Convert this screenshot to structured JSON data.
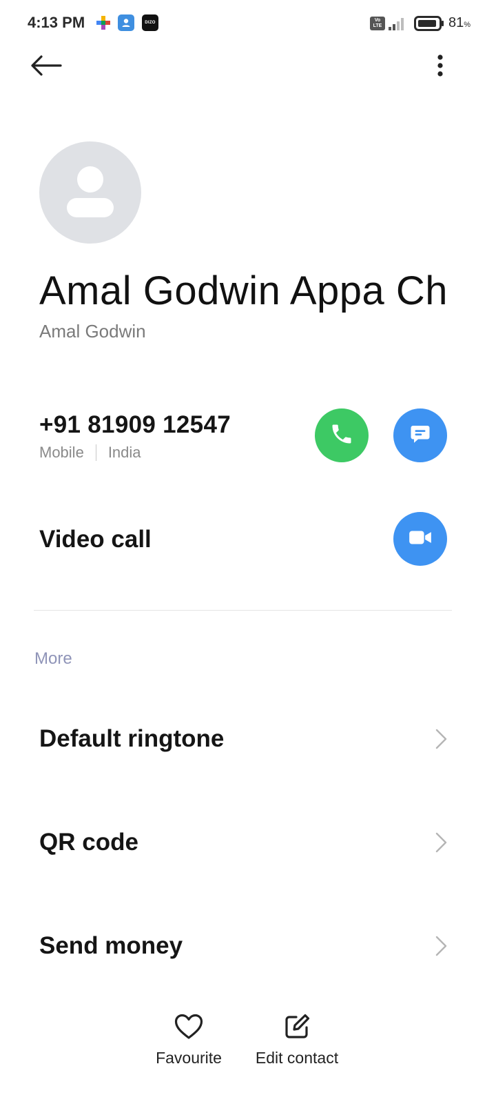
{
  "status_bar": {
    "time": "4:13 PM",
    "icons": [
      "puzzle-app-icon",
      "contacts-app-icon",
      "dizo-app-icon"
    ],
    "dizo_label": "DIZO",
    "volte_label": "Vo LTE",
    "battery_value": "81",
    "battery_unit": "%"
  },
  "top_bar": {
    "back_icon": "back-arrow-icon",
    "more_icon": "more-vert-icon"
  },
  "contact": {
    "name": "Amal Godwin Appa Ch",
    "subname": "Amal Godwin"
  },
  "phone": {
    "number": "+91 81909 12547",
    "type": "Mobile",
    "location": "India"
  },
  "video_call": {
    "label": "Video call"
  },
  "more_section": {
    "label": "More",
    "items": [
      {
        "label": "Default ringtone"
      },
      {
        "label": "QR code"
      },
      {
        "label": "Send money"
      }
    ]
  },
  "bottom_actions": {
    "favourite": "Favourite",
    "edit": "Edit contact"
  },
  "colors": {
    "call_green": "#3dc964",
    "action_blue": "#3e93f2",
    "avatar_bg": "#dfe1e5",
    "section_label": "#8f94b8"
  }
}
